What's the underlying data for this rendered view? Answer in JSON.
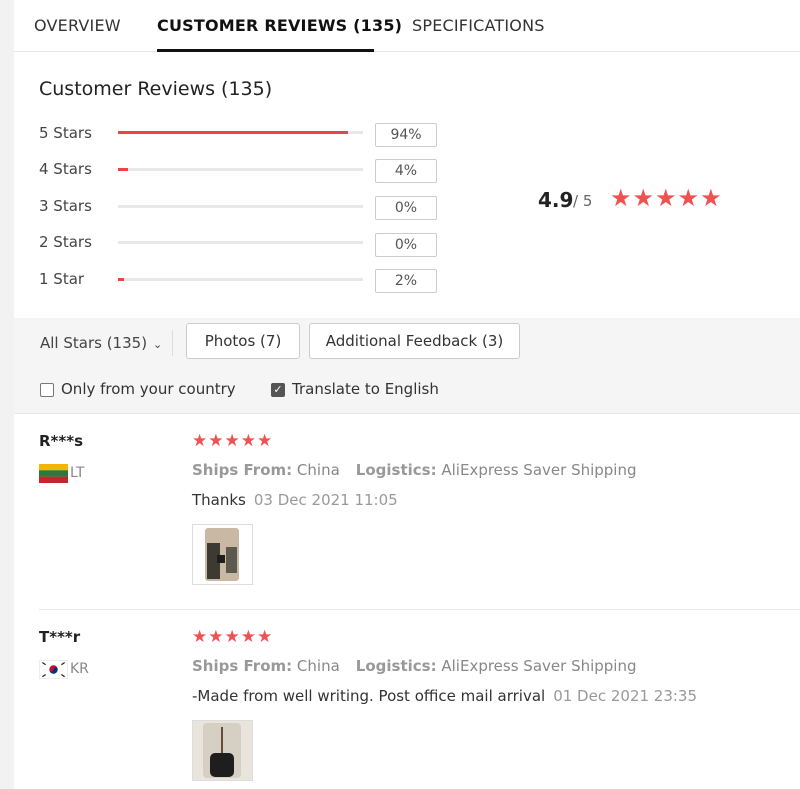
{
  "tabs": [
    {
      "label": "OVERVIEW"
    },
    {
      "label": "CUSTOMER REVIEWS (135)"
    },
    {
      "label": "SPECIFICATIONS"
    }
  ],
  "summary": {
    "title": "Customer Reviews (135)",
    "rows": [
      {
        "label": "5 Stars",
        "pct_text": "94%",
        "pct": 0.94
      },
      {
        "label": "4 Stars",
        "pct_text": "4%",
        "pct": 0.04
      },
      {
        "label": "3 Stars",
        "pct_text": "0%",
        "pct": 0
      },
      {
        "label": "2 Stars",
        "pct_text": "0%",
        "pct": 0
      },
      {
        "label": "1 Star",
        "pct_text": "2%",
        "pct": 0.02
      }
    ],
    "score": "4.9",
    "score_denominator": "/ 5",
    "stars": "★★★★★",
    "accent_color": "#e84545"
  },
  "filters": {
    "all_stars": "All Stars (135)",
    "photos": "Photos (7)",
    "additional": "Additional Feedback (3)",
    "only_country": "Only from your country",
    "translate": "Translate to English",
    "translate_checked": true
  },
  "reviews": [
    {
      "name": "R***s",
      "country": "LT",
      "flag_icon": "lithuania-flag-icon",
      "stars": "★★★★★",
      "ships_from_label": "Ships From:",
      "ships_from": "China",
      "logistics_label": "Logistics:",
      "logistics": "AliExpress Saver Shipping",
      "text": "Thanks",
      "date": "03 Dec 2021 11:05"
    },
    {
      "name": "T***r",
      "country": "KR",
      "flag_icon": "south-korea-flag-icon",
      "stars": "★★★★★",
      "ships_from_label": "Ships From:",
      "ships_from": "China",
      "logistics_label": "Logistics:",
      "logistics": "AliExpress Saver Shipping",
      "text": "-Made from well writing. Post office mail arrival",
      "date": "01 Dec 2021 23:35"
    }
  ]
}
